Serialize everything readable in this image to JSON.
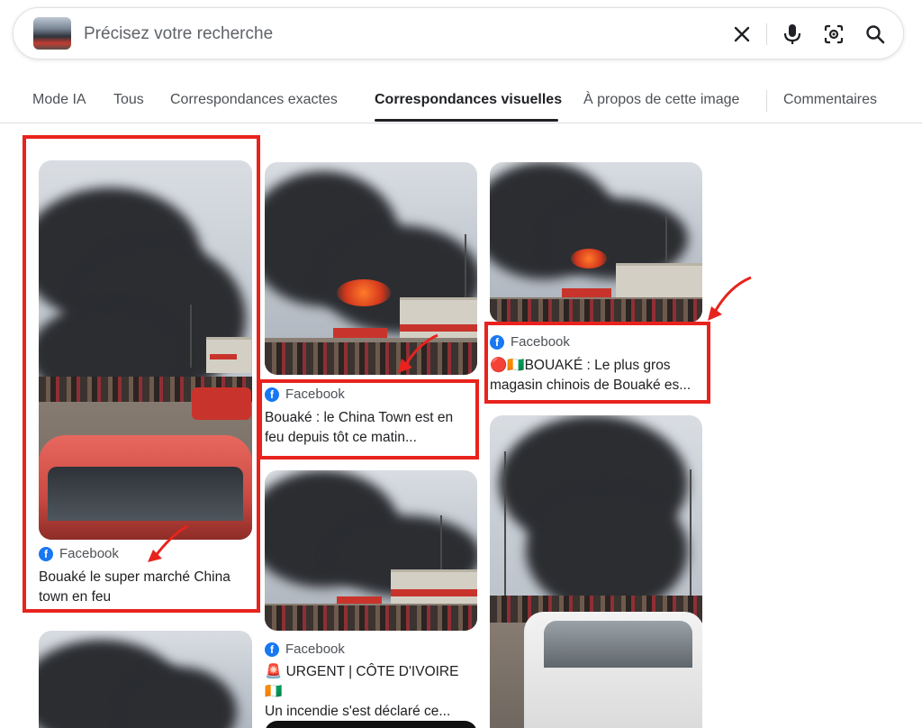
{
  "search": {
    "placeholder": "Précisez votre recherche"
  },
  "tabs": [
    {
      "label": "Mode IA"
    },
    {
      "label": "Tous"
    },
    {
      "label": "Correspondances exactes"
    },
    {
      "label": "Correspondances visuelles",
      "active": true
    },
    {
      "label": "À propos de cette image"
    },
    {
      "label": "Commentaires"
    }
  ],
  "results": [
    {
      "source": "Facebook",
      "title_line1": "Bouaké le super marché China",
      "title_line2": "town en feu"
    },
    {
      "source": "Facebook",
      "title_line1": "Bouaké : le China Town est en",
      "title_line2": "feu depuis tôt ce matin..."
    },
    {
      "source": "Facebook",
      "title_line1": "🔴🇨🇮BOUAKÉ : Le plus gros",
      "title_line2": "magasin chinois de Bouaké es..."
    },
    {
      "source": "Facebook",
      "title_line1": "🚨 URGENT | CÔTE D'IVOIRE 🇨🇮",
      "title_line2": "Un incendie s'est déclaré ce..."
    }
  ],
  "colors": {
    "annotation": "#e8231d",
    "facebook": "#1877f2",
    "active_tab_underline": "#202124"
  },
  "icons": [
    "clear-icon",
    "microphone-icon",
    "camera-lens-icon",
    "search-icon",
    "facebook-icon",
    "arrow-annotation"
  ]
}
